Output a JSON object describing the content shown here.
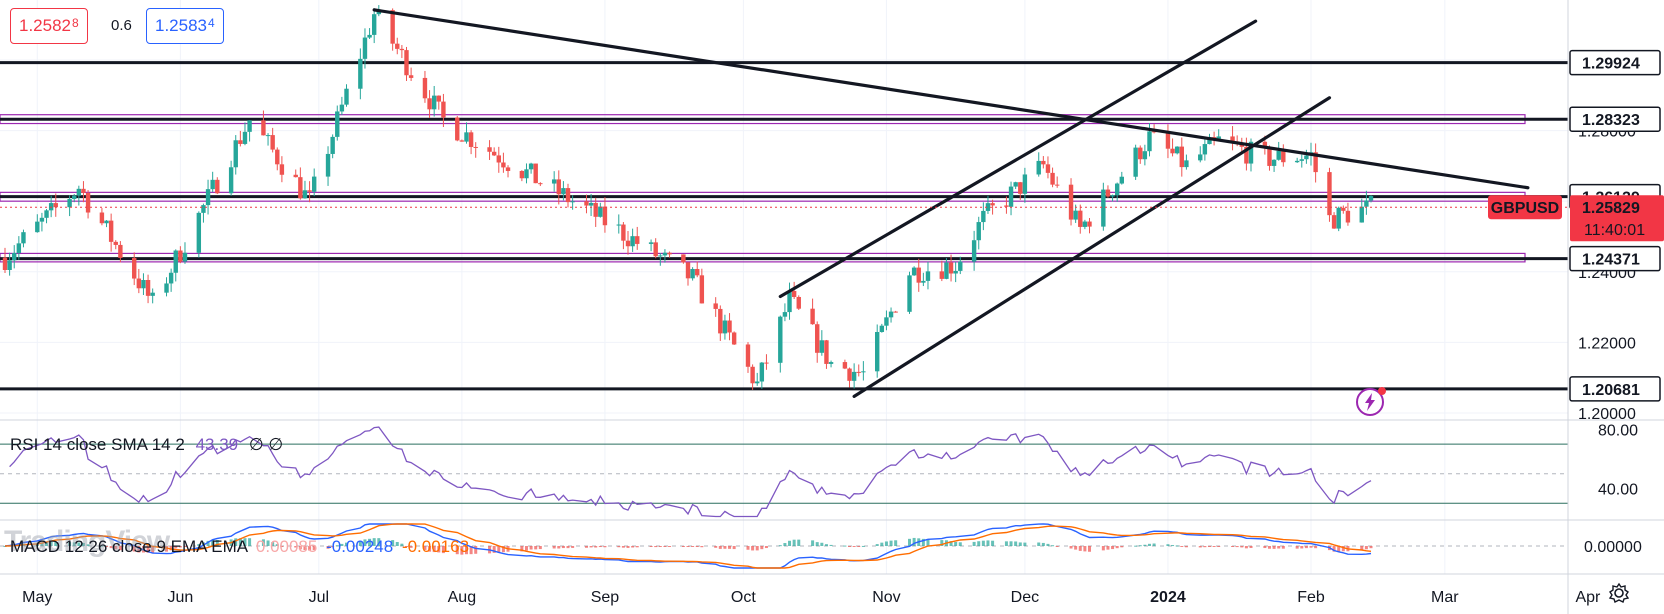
{
  "quotes": {
    "bid": "1.2582",
    "bid_sup": "8",
    "spread": "0.6",
    "ask": "1.2583",
    "ask_sup": "4"
  },
  "symbol": {
    "name": "GBPUSD",
    "price": "1.25829",
    "countdown": "11:40:01"
  },
  "levels": [
    "1.29924",
    "1.28323",
    "1.26129",
    "1.24371",
    "1.20681"
  ],
  "price_ticks": [
    "1.28000",
    "1.24000",
    "1.22000",
    "1.20000"
  ],
  "rsi": {
    "label": "RSI 14 close SMA 14 2",
    "value": "43.39",
    "extra": "∅ ∅",
    "ticks": [
      "80.00",
      "40.00"
    ]
  },
  "macd": {
    "label": "MACD 12 26 close 9 EMA EMA",
    "hist": "0.00085",
    "macd": "-0.00248",
    "signal": "-0.00163",
    "tick": "0.00000"
  },
  "time_labels": [
    "May",
    "Jun",
    "Jul",
    "Aug",
    "Sep",
    "Oct",
    "Nov",
    "Dec",
    "2024",
    "Feb",
    "Mar",
    "Apr"
  ],
  "watermark": "TradingView",
  "colors": {
    "up": "#26a69a",
    "down": "#ef5350",
    "rsi": "#7e57c2",
    "macd": "#2962ff",
    "signal": "#ff6d00",
    "channel": "#9c27b0",
    "badge": "#f23645"
  },
  "chart_data": {
    "type": "candlestick",
    "symbol": "GBPUSD",
    "x_range": [
      "2023-04-24",
      "2024-02-14"
    ],
    "price_range": [
      1.198,
      1.317
    ],
    "horizontal_levels": [
      1.29924,
      1.28323,
      1.26129,
      1.24371,
      1.20681
    ],
    "zones": [
      [
        1.282,
        1.2845
      ],
      [
        1.26,
        1.2625
      ],
      [
        1.2428,
        1.2452
      ]
    ],
    "trendlines": [
      {
        "from": [
          "2023-07-13",
          1.3142
        ],
        "to": [
          "2024-03-19",
          1.2638
        ]
      },
      {
        "from": [
          "2023-10-09",
          1.233
        ],
        "to": [
          "2024-01-20",
          1.311
        ]
      },
      {
        "from": [
          "2023-10-25",
          1.2047
        ],
        "to": [
          "2024-02-05",
          1.2893
        ]
      }
    ],
    "last_price": 1.25829,
    "rsi": {
      "period": 14,
      "ylim": [
        20,
        85
      ],
      "bands": [
        70,
        30
      ],
      "last": 43.39
    },
    "macd": {
      "fast": 12,
      "slow": 26,
      "signal": 9,
      "histogram": 0.00085,
      "macd": -0.00248,
      "signal_value": -0.00163
    }
  }
}
